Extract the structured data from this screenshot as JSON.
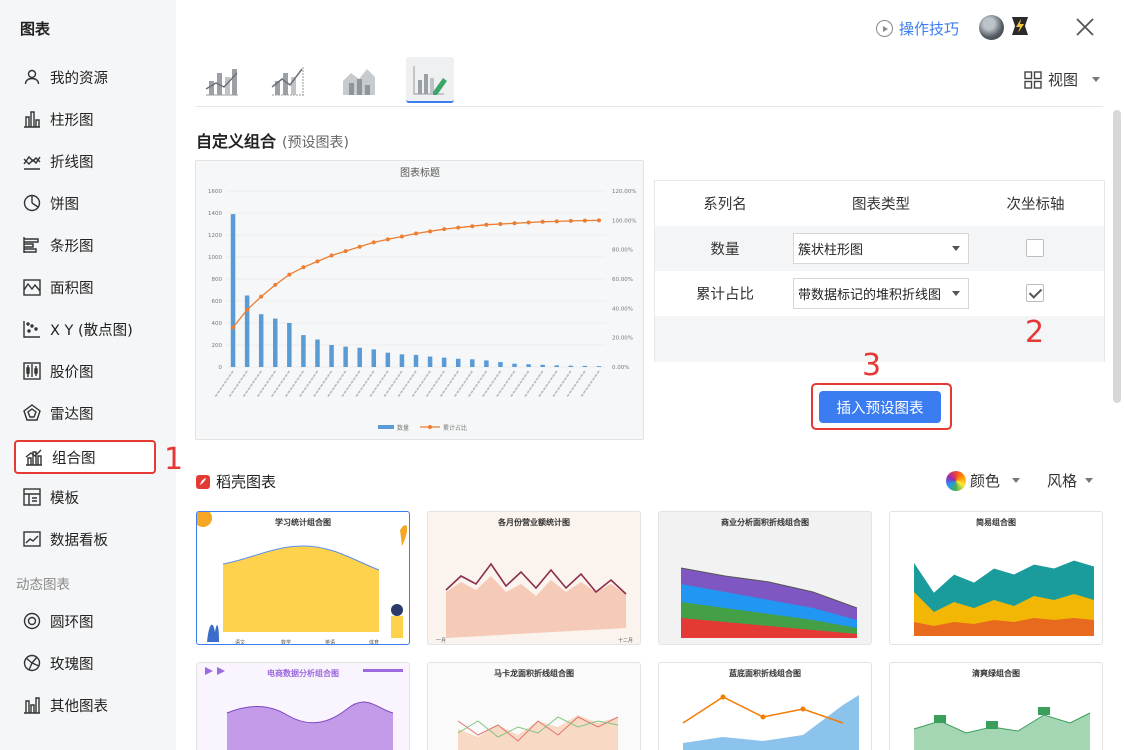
{
  "sidebar": {
    "title": "图表",
    "items": [
      {
        "label": "我的资源",
        "icon": "user-icon"
      },
      {
        "label": "柱形图",
        "icon": "bar-chart-icon"
      },
      {
        "label": "折线图",
        "icon": "line-chart-icon"
      },
      {
        "label": "饼图",
        "icon": "pie-chart-icon"
      },
      {
        "label": "条形图",
        "icon": "horizontal-bar-icon"
      },
      {
        "label": "面积图",
        "icon": "area-chart-icon"
      },
      {
        "label": "X Y (散点图)",
        "icon": "scatter-chart-icon"
      },
      {
        "label": "股价图",
        "icon": "stock-chart-icon"
      },
      {
        "label": "雷达图",
        "icon": "radar-chart-icon"
      },
      {
        "label": "组合图",
        "icon": "combo-chart-icon"
      },
      {
        "label": "模板",
        "icon": "template-icon"
      },
      {
        "label": "数据看板",
        "icon": "dashboard-icon"
      }
    ],
    "section_label": "动态图表",
    "dynamic_items": [
      {
        "label": "圆环图",
        "icon": "donut-chart-icon"
      },
      {
        "label": "玫瑰图",
        "icon": "rose-chart-icon"
      },
      {
        "label": "其他图表",
        "icon": "other-chart-icon"
      }
    ]
  },
  "annotations": {
    "one": "1",
    "two": "2",
    "three": "3"
  },
  "header": {
    "tips_label": "操作技巧",
    "view_label": "视图"
  },
  "section": {
    "title": "自定义组合",
    "subtitle": "(预设图表)"
  },
  "preview_chart": {
    "title": "图表标题",
    "left_axis_ticks": [
      "1600",
      "1400",
      "1200",
      "1000",
      "800",
      "600",
      "400",
      "200",
      "0"
    ],
    "right_axis_ticks": [
      "120.00%",
      "100.00%",
      "80.00%",
      "60.00%",
      "40.00%",
      "20.00%",
      "0.00%"
    ],
    "legend": [
      "数量",
      "累计占比"
    ],
    "colors": {
      "bar": "#5b9bd5",
      "line": "#ed7d31"
    }
  },
  "chart_data": {
    "type": "bar",
    "title": "图表标题",
    "ylim": [
      0,
      1600
    ],
    "y2lim": [
      0,
      1.2
    ],
    "series": [
      {
        "name": "数量",
        "type": "bar",
        "values": [
          1390,
          650,
          480,
          440,
          400,
          290,
          250,
          200,
          185,
          175,
          160,
          130,
          115,
          110,
          95,
          85,
          75,
          70,
          60,
          45,
          30,
          25,
          20,
          15,
          12,
          10,
          8
        ]
      },
      {
        "name": "累计占比",
        "type": "line",
        "axis": "secondary",
        "values": [
          0.27,
          0.39,
          0.48,
          0.56,
          0.63,
          0.68,
          0.72,
          0.76,
          0.79,
          0.82,
          0.85,
          0.87,
          0.89,
          0.91,
          0.925,
          0.94,
          0.95,
          0.96,
          0.97,
          0.975,
          0.98,
          0.985,
          0.99,
          0.993,
          0.996,
          0.998,
          1.0
        ]
      }
    ]
  },
  "series_table": {
    "headers": [
      "系列名",
      "图表类型",
      "次坐标轴"
    ],
    "rows": [
      {
        "name": "数量",
        "type": "簇状柱形图",
        "secondary": false
      },
      {
        "name": "累计占比",
        "type": "带数据标记的堆积折线图",
        "secondary": true
      }
    ]
  },
  "insert_button_label": "插入预设图表",
  "templates": {
    "source_label": "稻壳图表",
    "color_label": "颜色",
    "style_label": "风格",
    "items": [
      {
        "title": "学习统计组合图"
      },
      {
        "title": "各月份营业额统计图"
      },
      {
        "title": "商业分析面积折线组合图"
      },
      {
        "title": "简易组合图"
      },
      {
        "title": "电商数据分析组合图"
      },
      {
        "title": "马卡龙面积折线组合图"
      },
      {
        "title": "蓝底面积折线组合图"
      },
      {
        "title": "清爽绿组合图"
      }
    ]
  }
}
